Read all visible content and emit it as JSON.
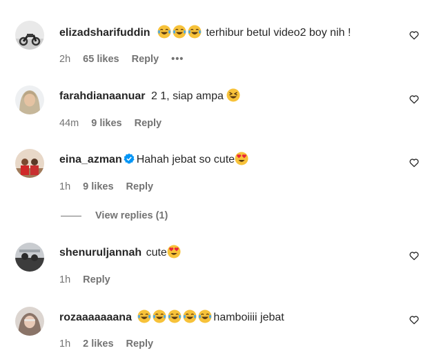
{
  "comments": [
    {
      "username": "elizadsharifuddin",
      "text": " terhibur betul video2 boy nih !",
      "emoji_before": 3,
      "emoji_type": "laugh-cry",
      "time": "2h",
      "likes": "65 likes",
      "reply": "Reply",
      "more": "•••"
    },
    {
      "username": "farahdianaanuar",
      "text": "2 1, siap ampa ",
      "emoji_after": 1,
      "emoji_type": "squint-laugh",
      "time": "44m",
      "likes": "9 likes",
      "reply": "Reply"
    },
    {
      "username": "eina_azman",
      "verified": true,
      "text": "Hahah jebat so cute",
      "emoji_after": 1,
      "emoji_type": "heart-eyes",
      "time": "1h",
      "likes": "9 likes",
      "reply": "Reply"
    },
    {
      "username": "shenuruljannah",
      "text": "cute",
      "emoji_after": 1,
      "emoji_type": "heart-eyes",
      "time": "1h",
      "reply": "Reply"
    },
    {
      "username": "rozaaaaaaana",
      "text": "hamboiiii jebat",
      "emoji_before": 5,
      "emoji_type": "laugh-cry",
      "time": "1h",
      "likes": "2 likes",
      "reply": "Reply"
    }
  ],
  "view_replies": "View replies (1)",
  "icons": {
    "heart": "heart-outline-icon",
    "verified": "verified-badge-icon"
  },
  "colors": {
    "text": "#262626",
    "meta": "#737373",
    "verified": "#0095f6"
  }
}
